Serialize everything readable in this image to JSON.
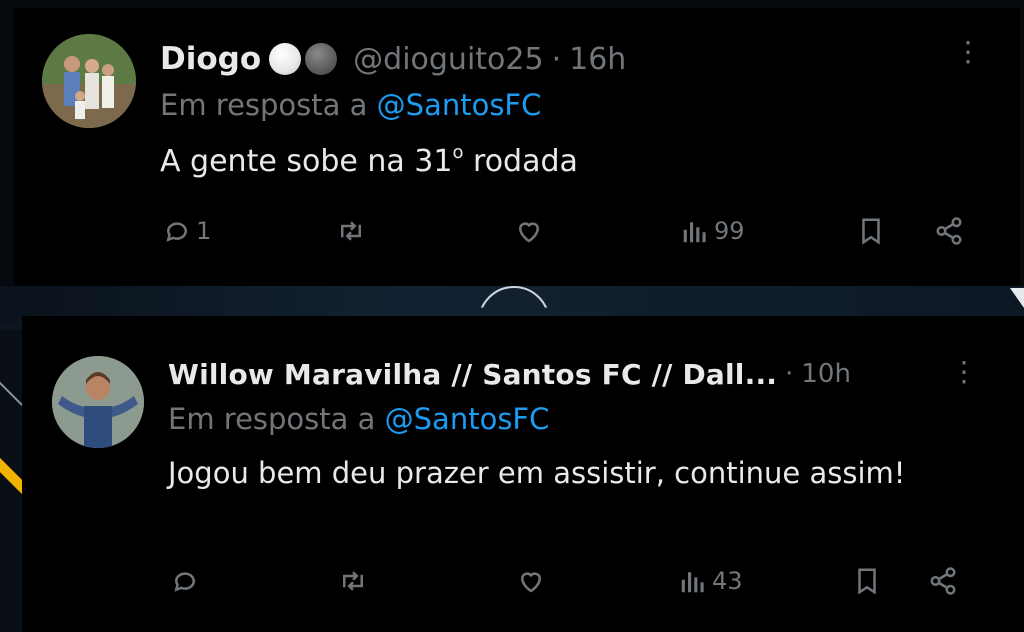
{
  "tweets": [
    {
      "name": "Diogo",
      "handle": "@dioguito25",
      "time": "16h",
      "reply_prefix": "Em resposta a",
      "reply_to": "@SantosFC",
      "text_main": "A gente sobe na 31",
      "text_sup": "o",
      "text_tail": " rodada",
      "replies": "1",
      "views": "99"
    },
    {
      "name": "Willow Maravilha // Santos FC // Dall...",
      "time": "10h",
      "reply_prefix": "Em resposta a",
      "reply_to": "@SantosFC",
      "text": "Jogou bem deu prazer em assistir, continue assim!",
      "replies": "",
      "views": "43"
    }
  ],
  "separator": "·",
  "more_glyph": "⋮",
  "icons": [
    "reply-icon",
    "retweet-icon",
    "like-icon",
    "views-icon",
    "bookmark-icon",
    "share-icon",
    "more-icon"
  ],
  "colors": {
    "background": "#000000",
    "text": "#e7e9ea",
    "muted": "#71767b",
    "link": "#1d9bf0"
  }
}
